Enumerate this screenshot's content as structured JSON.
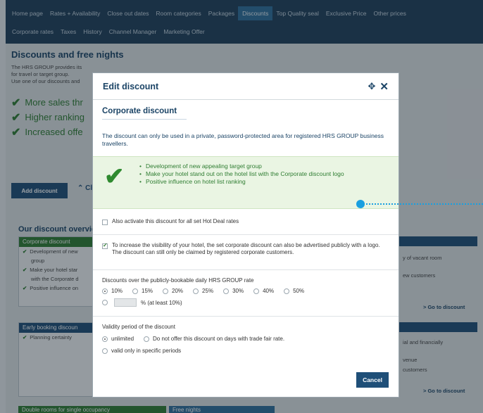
{
  "nav": {
    "row1": [
      "Home page",
      "Rates + Availability",
      "Close out dates",
      "Room categories",
      "Packages",
      "Discounts",
      "Top Quality seal",
      "Exclusive Price",
      "Other prices"
    ],
    "row2": [
      "Corporate rates",
      "Taxes",
      "History",
      "Channel Manager",
      "Marketing Offer"
    ],
    "active": "Discounts"
  },
  "page": {
    "title": "Discounts and free nights",
    "intro": [
      "The HRS GROUP provides its",
      "for travel or target group.",
      "Use one of our discounts and"
    ],
    "benefits": [
      "More sales thr",
      "Higher ranking",
      "Increased offe"
    ],
    "add_discount": "Add discount",
    "chevron_label": "Cl",
    "overview_title": "Our discount overvie",
    "corporate_panel": {
      "title": "Corporate discount",
      "items": [
        "Development of new",
        "group",
        "Make your hotel star",
        "with the Corporate d",
        "Positive influence on"
      ]
    },
    "early_panel": {
      "title": "Early booking discoun",
      "items": [
        "Planning certainty"
      ]
    },
    "right_texts": [
      "y of vacant room",
      "ew customers",
      "ial and financially",
      "venue",
      "customers"
    ],
    "goto": "> Go to discount",
    "bottom_tabs": [
      "Double rooms for single occupancy",
      "Free nights"
    ]
  },
  "modal": {
    "title": "Edit discount",
    "subtitle": "Corporate discount",
    "description": "The discount can only be used in a private, password-protected area for registered HRS GROUP business travellers.",
    "bullets": [
      "Development of new appealing target group",
      "Make your hotel stand out on the hotel list with the Corporate discount logo",
      "Positive influence on hotel list ranking"
    ],
    "hot_deal": "Also activate this discount for all set Hot Deal rates",
    "visibility": "To increase the visibility of your hotel, the set corporate discount can also be advertised publicly with a logo. The discount can still only be claimed by registered corporate customers.",
    "rate_label": "Discounts over the publicly-bookable daily HRS GROUP rate",
    "rate_options": [
      "10%",
      "15%",
      "20%",
      "25%",
      "30%",
      "40%",
      "50%"
    ],
    "rate_selected": "10%",
    "custom_suffix": "% (at least 10%)",
    "validity_label": "Validity period of the discount",
    "validity_options": [
      "unlimited",
      "Do not offer this discount on days with trade fair rate.",
      "valid only in specific periods"
    ],
    "cancel": "Cancel"
  },
  "colors": {
    "nav_bg": "#1f3f5b",
    "brand_blue": "#1f4f78",
    "success_green": "#2f7d32",
    "annotation": "#1a9fe0"
  }
}
